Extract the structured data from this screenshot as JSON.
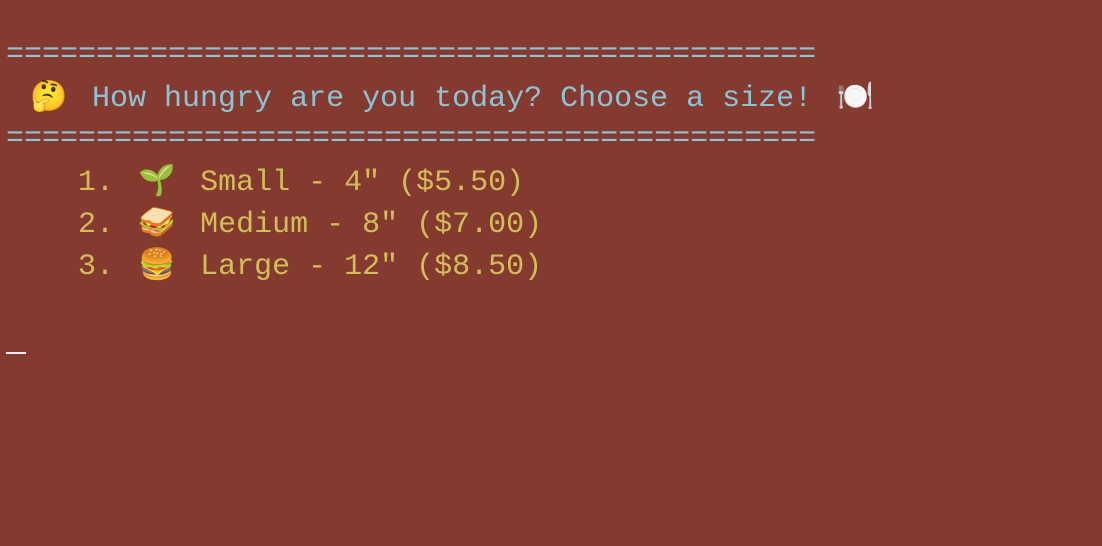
{
  "header": {
    "rule_top": "=============================================",
    "prompt_emoji": "🤔",
    "prompt_text": "How hungry are you today? Choose a size!",
    "trailing_emoji": "🍽️",
    "rule_bottom": "============================================="
  },
  "menu": {
    "items": [
      {
        "number": "1.",
        "emoji": "🌱",
        "label": "Small - 4\" ($5.50)"
      },
      {
        "number": "2.",
        "emoji": "🥪",
        "label": "Medium - 8\" ($7.00)"
      },
      {
        "number": "3.",
        "emoji": "🍔",
        "label": "Large - 12\" ($8.50)"
      }
    ]
  },
  "colors": {
    "background": "#853A2F",
    "rule_and_prompt": "#8EC3D6",
    "menu_text": "#D3BD59",
    "cursor": "#EDEDED"
  },
  "icons": {
    "prompt": "thinking-face-icon",
    "trailing": "fork-knife-plate-icon",
    "small": "seedling-icon",
    "medium": "sandwich-icon",
    "large": "burger-icon"
  }
}
